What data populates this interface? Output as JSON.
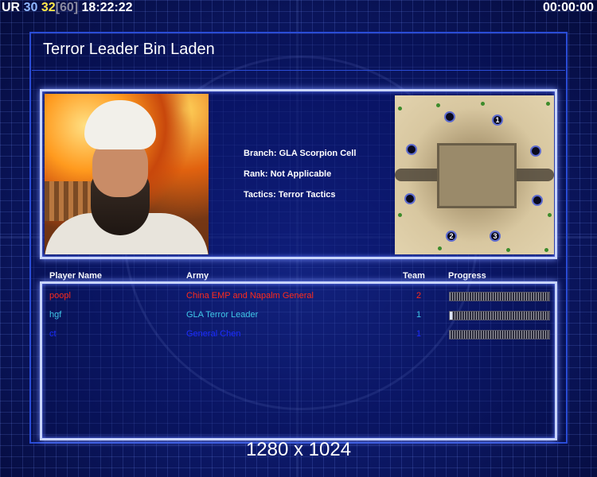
{
  "hud": {
    "ur_label": "UR",
    "ur_value": "30",
    "fps_current": "32",
    "fps_limit": "[60]",
    "clock": "18:22:22",
    "timer": "00:00:00"
  },
  "title": "Terror Leader Bin Laden",
  "details": {
    "branch": "Branch: GLA Scorpion Cell",
    "rank": "Rank: Not Applicable",
    "tactics": "Tactics: Terror Tactics"
  },
  "map": {
    "start_positions": [
      "",
      "1",
      "",
      "",
      "",
      "",
      "2",
      "3"
    ]
  },
  "table": {
    "headers": {
      "player_name": "Player Name",
      "army": "Army",
      "team": "Team",
      "progress": "Progress"
    },
    "rows": [
      {
        "player": "poopl",
        "army": "China EMP and Napalm General",
        "team": "2",
        "color": "#ff2a1a",
        "progress": 0
      },
      {
        "player": "hgf",
        "army": "GLA Terror Leader",
        "team": "1",
        "color": "#3fc7e8",
        "progress": 0.02
      },
      {
        "player": "ct",
        "army": "General Chen",
        "team": "1",
        "color": "#1b2cff",
        "progress": 0
      }
    ]
  },
  "resolution": "1280 x 1024"
}
